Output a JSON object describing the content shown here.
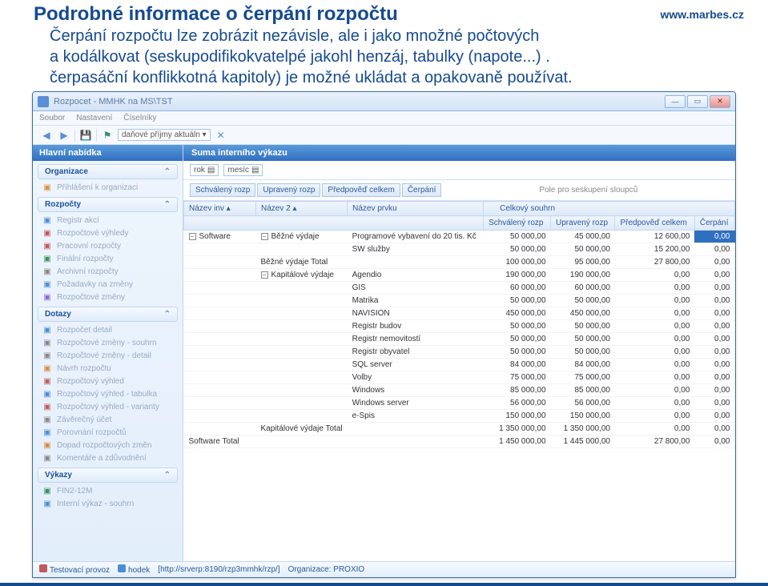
{
  "slide": {
    "title": "Podrobné informace o čerpání rozpočtu",
    "site": "www.marbes.cz",
    "body_line1": "Čerpání rozpočtu lze zobrázit nezávisle, ale i jako množné počtových",
    "body_line2": "a kodálkovat (seskupodifikokvatelpé jakohl henzáj, tabulky (napote...) .",
    "body_line3": "čerpasáční konflikkotná kapitoly) je možné ukládat a opakovaně používat."
  },
  "window": {
    "title": "Rozpocet - MMHK na MS\\TST",
    "menu": [
      "Soubor",
      "Nastavení",
      "Číselníky"
    ],
    "toolbar_text": "daňové příjmy aktuáln"
  },
  "left": {
    "main_title": "Hlavní nabídka",
    "groups": {
      "organizace": {
        "label": "Organizace",
        "items": [
          {
            "icon": "orange",
            "label": "Příhlášení k organizaci"
          }
        ]
      },
      "rozpocty": {
        "label": "Rozpočty",
        "items": [
          {
            "icon": "blue",
            "label": "Registr akcí"
          },
          {
            "icon": "red",
            "label": "Rozpočtové výhledy"
          },
          {
            "icon": "red",
            "label": "Pracovní rozpočty"
          },
          {
            "icon": "green",
            "label": "Finální rozpočty"
          },
          {
            "icon": "gray",
            "label": "Archivní rozpočty"
          },
          {
            "icon": "blue",
            "label": "Požadavky na změny"
          },
          {
            "icon": "purple",
            "label": "Rozpočtové změny"
          }
        ]
      },
      "dotazy": {
        "label": "Dotazy",
        "items": [
          {
            "icon": "blue",
            "label": "Rozpočet detail"
          },
          {
            "icon": "gray",
            "label": "Rozpočtové změny - souhrn"
          },
          {
            "icon": "gray",
            "label": "Rozpočtové změny - detail"
          },
          {
            "icon": "orange",
            "label": "Návrh rozpočtu"
          },
          {
            "icon": "red",
            "label": "Rozpočtový výhled"
          },
          {
            "icon": "blue",
            "label": "Rozpočtový výhled - tabulka"
          },
          {
            "icon": "red",
            "label": "Rozpočtový výhled - varianty"
          },
          {
            "icon": "gray",
            "label": "Závěrečný účet"
          },
          {
            "icon": "blue",
            "label": "Porovnání rozpočtů"
          },
          {
            "icon": "orange",
            "label": "Dopad rozpočtových změn"
          },
          {
            "icon": "gray",
            "label": "Komentáře a zdůvodnění"
          }
        ]
      },
      "vykazy": {
        "label": "Výkazy",
        "items": [
          {
            "icon": "green",
            "label": "FIN2-12M"
          },
          {
            "icon": "blue",
            "label": "Interní výkaz - souhrn"
          }
        ]
      }
    }
  },
  "content": {
    "tab_title": "Suma interního výkazu",
    "filter": {
      "rok_label": "rok",
      "mesic_label": "mesíc"
    },
    "col_chips": [
      "Schválený rozp",
      "Upravený rozp",
      "Předpověď celkem",
      "Čerpání"
    ],
    "group_hint": "Pole pro seskupení sloupců",
    "summary_label": "Celkový souhrn",
    "headers_left": {
      "nazev_inv": "Název inv",
      "nazev2": "Název 2",
      "nazev_prvku": "Název prvku"
    },
    "headers_right": {
      "schvaleny": "Schválený rozp",
      "upraveny": "Upravený rozp",
      "predpoved": "Předpověď celkem",
      "cerpani": "Čerpání"
    },
    "rows_left": [
      {
        "inv": "Software",
        "n2": "Běžné výdaje",
        "prvek": "Programové vybavení do 20 tis. Kč"
      },
      {
        "inv": "",
        "n2": "",
        "prvek": "SW služby"
      },
      {
        "inv": "",
        "n2": "Běžné výdaje Total",
        "prvek": ""
      },
      {
        "inv": "",
        "n2": "Kapitálové výdaje",
        "prvek": "Agendio"
      },
      {
        "inv": "",
        "n2": "",
        "prvek": "GIS"
      },
      {
        "inv": "",
        "n2": "",
        "prvek": "Matrika"
      },
      {
        "inv": "",
        "n2": "",
        "prvek": "NAVISION"
      },
      {
        "inv": "",
        "n2": "",
        "prvek": "Registr budov"
      },
      {
        "inv": "",
        "n2": "",
        "prvek": "Registr nemovitostí"
      },
      {
        "inv": "",
        "n2": "",
        "prvek": "Registr obyvatel"
      },
      {
        "inv": "",
        "n2": "",
        "prvek": "SQL server"
      },
      {
        "inv": "",
        "n2": "",
        "prvek": "Volby"
      },
      {
        "inv": "",
        "n2": "",
        "prvek": "Windows"
      },
      {
        "inv": "",
        "n2": "",
        "prvek": "Windows server"
      },
      {
        "inv": "",
        "n2": "",
        "prvek": "e-Spis"
      },
      {
        "inv": "",
        "n2": "Kapitálové výdaje Total",
        "prvek": ""
      },
      {
        "inv": "Software Total",
        "n2": "",
        "prvek": ""
      }
    ],
    "rows_right": [
      {
        "s": "50 000,00",
        "u": "45 000,00",
        "p": "12 600,00",
        "c": "0,00",
        "sel": true
      },
      {
        "s": "50 000,00",
        "u": "50 000,00",
        "p": "15 200,00",
        "c": "0,00"
      },
      {
        "s": "100 000,00",
        "u": "95 000,00",
        "p": "27 800,00",
        "c": "0,00"
      },
      {
        "s": "190 000,00",
        "u": "190 000,00",
        "p": "0,00",
        "c": "0,00"
      },
      {
        "s": "60 000,00",
        "u": "60 000,00",
        "p": "0,00",
        "c": "0,00"
      },
      {
        "s": "50 000,00",
        "u": "50 000,00",
        "p": "0,00",
        "c": "0,00"
      },
      {
        "s": "450 000,00",
        "u": "450 000,00",
        "p": "0,00",
        "c": "0,00"
      },
      {
        "s": "50 000,00",
        "u": "50 000,00",
        "p": "0,00",
        "c": "0,00"
      },
      {
        "s": "50 000,00",
        "u": "50 000,00",
        "p": "0,00",
        "c": "0,00"
      },
      {
        "s": "50 000,00",
        "u": "50 000,00",
        "p": "0,00",
        "c": "0,00"
      },
      {
        "s": "84 000,00",
        "u": "84 000,00",
        "p": "0,00",
        "c": "0,00"
      },
      {
        "s": "75 000,00",
        "u": "75 000,00",
        "p": "0,00",
        "c": "0,00"
      },
      {
        "s": "85 000,00",
        "u": "85 000,00",
        "p": "0,00",
        "c": "0,00"
      },
      {
        "s": "56 000,00",
        "u": "56 000,00",
        "p": "0,00",
        "c": "0,00"
      },
      {
        "s": "150 000,00",
        "u": "150 000,00",
        "p": "0,00",
        "c": "0,00"
      },
      {
        "s": "1 350 000,00",
        "u": "1 350 000,00",
        "p": "0,00",
        "c": "0,00"
      },
      {
        "s": "1 450 000,00",
        "u": "1 445 000,00",
        "p": "27 800,00",
        "c": "0,00"
      }
    ]
  },
  "status": {
    "env": "Testovací provoz",
    "user": "hodek",
    "url": "[http://srverp:8190/rzp3mmhk/rzp/]",
    "org": "Organizace: PROXIO"
  }
}
